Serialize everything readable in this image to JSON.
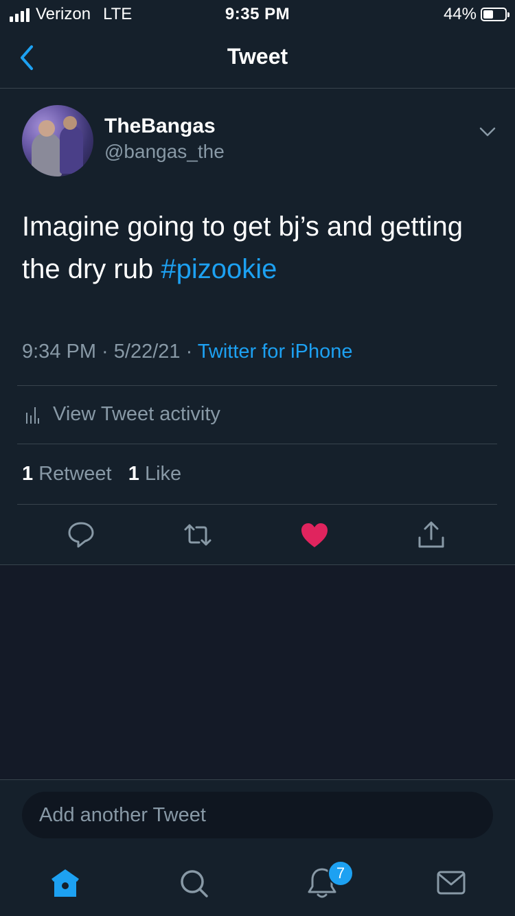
{
  "status_bar": {
    "carrier": "Verizon",
    "network": "LTE",
    "time": "9:35 PM",
    "battery_percent": "44%",
    "battery_level": 0.44,
    "signal_bars": 4
  },
  "header": {
    "title": "Tweet"
  },
  "tweet": {
    "display_name": "TheBangas",
    "username": "@bangas_the",
    "text": "Imagine going to get bj’s and getting the dry rub ",
    "hashtag": "#pizookie",
    "time": "9:34 PM",
    "separator": " · ",
    "date": "5/22/21",
    "source": "Twitter for iPhone",
    "activity_label": "View Tweet activity",
    "retweet_count": "1",
    "retweet_label": "Retweet",
    "like_count": "1",
    "like_label": "Like",
    "liked": true
  },
  "reply": {
    "placeholder": "Add another Tweet"
  },
  "tabbar": {
    "items": [
      {
        "name": "home",
        "icon": "home-icon",
        "active": true
      },
      {
        "name": "search",
        "icon": "search-icon"
      },
      {
        "name": "notifications",
        "icon": "bell-icon"
      },
      {
        "name": "messages",
        "icon": "mail-icon"
      }
    ],
    "notification_badge": "7"
  },
  "colors": {
    "background": "#15202b",
    "accent": "#1da1f2",
    "like": "#e0245e",
    "secondary_text": "#8899a6",
    "divider": "#38444d"
  }
}
